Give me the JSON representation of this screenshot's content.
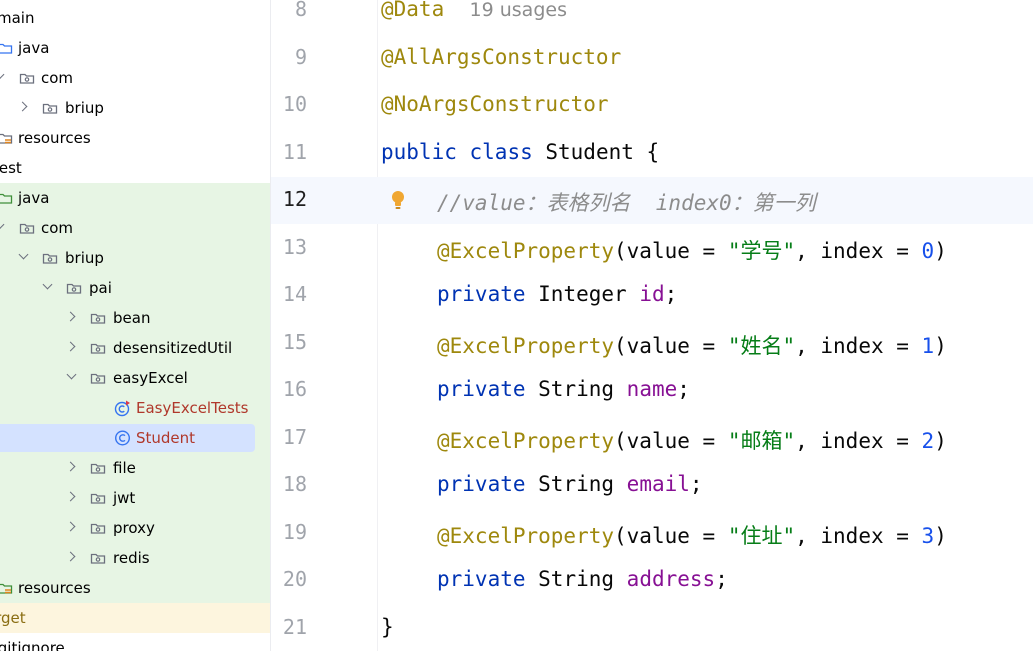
{
  "project_tree": {
    "rows": [
      {
        "label": "main",
        "icon": "none",
        "type": "folder"
      },
      {
        "label": "java",
        "icon": "source-folder-icon",
        "type": "folder"
      },
      {
        "label": "com",
        "icon": "package-icon",
        "type": "package"
      },
      {
        "label": "briup",
        "icon": "package-icon",
        "type": "package"
      },
      {
        "label": "resources",
        "icon": "resources-folder-icon",
        "type": "folder"
      },
      {
        "label": "test",
        "icon": "none",
        "type": "folder"
      },
      {
        "label": "java",
        "icon": "test-source-folder-icon",
        "type": "folder"
      },
      {
        "label": "com",
        "icon": "package-icon",
        "type": "package"
      },
      {
        "label": "briup",
        "icon": "package-icon",
        "type": "package"
      },
      {
        "label": "pai",
        "icon": "package-icon",
        "type": "package"
      },
      {
        "label": "bean",
        "icon": "package-icon",
        "type": "package"
      },
      {
        "label": "desensitizedUtil",
        "icon": "package-icon",
        "type": "package"
      },
      {
        "label": "easyExcel",
        "icon": "package-icon",
        "type": "package"
      },
      {
        "label": "EasyExcelTests",
        "icon": "test-class-icon",
        "type": "class"
      },
      {
        "label": "Student",
        "icon": "class-icon",
        "type": "class"
      },
      {
        "label": "file",
        "icon": "package-icon",
        "type": "package"
      },
      {
        "label": "jwt",
        "icon": "package-icon",
        "type": "package"
      },
      {
        "label": "proxy",
        "icon": "package-icon",
        "type": "package"
      },
      {
        "label": "redis",
        "icon": "package-icon",
        "type": "package"
      },
      {
        "label": "resources",
        "icon": "test-resources-folder-icon",
        "type": "folder"
      },
      {
        "label": "target",
        "icon": "none",
        "type": "folder"
      },
      {
        "label": ".gitignore",
        "icon": "none",
        "type": "file"
      }
    ],
    "selected": "Student"
  },
  "editor": {
    "hints": {
      "usages": "19 usages"
    },
    "lines": [
      {
        "num": "8",
        "tokens": [
          {
            "t": "@Data",
            "c": "ann"
          },
          {
            "t": "  ",
            "c": ""
          },
          {
            "t": "19 usages",
            "c": "hint"
          }
        ]
      },
      {
        "num": "9",
        "tokens": [
          {
            "t": "@AllArgsConstructor",
            "c": "ann"
          }
        ]
      },
      {
        "num": "10",
        "tokens": [
          {
            "t": "@NoArgsConstructor",
            "c": "ann"
          }
        ]
      },
      {
        "num": "11",
        "tokens": [
          {
            "t": "public ",
            "c": "kw"
          },
          {
            "t": "class ",
            "c": "kw"
          },
          {
            "t": "Student {",
            "c": ""
          }
        ]
      },
      {
        "num": "12",
        "tokens": [
          {
            "t": "//value：表格列名  index0：第一列",
            "c": "cmt"
          }
        ]
      },
      {
        "num": "13",
        "tokens": [
          {
            "t": "@ExcelProperty",
            "c": "ann"
          },
          {
            "t": "(value = ",
            "c": ""
          },
          {
            "t": "\"学号\"",
            "c": "str"
          },
          {
            "t": ", index = ",
            "c": ""
          },
          {
            "t": "0",
            "c": "num"
          },
          {
            "t": ")",
            "c": ""
          }
        ]
      },
      {
        "num": "14",
        "tokens": [
          {
            "t": "private ",
            "c": "kw"
          },
          {
            "t": "Integer ",
            "c": ""
          },
          {
            "t": "id",
            "c": "field"
          },
          {
            "t": ";",
            "c": ""
          }
        ]
      },
      {
        "num": "15",
        "tokens": [
          {
            "t": "@ExcelProperty",
            "c": "ann"
          },
          {
            "t": "(value = ",
            "c": ""
          },
          {
            "t": "\"姓名\"",
            "c": "str"
          },
          {
            "t": ", index = ",
            "c": ""
          },
          {
            "t": "1",
            "c": "num"
          },
          {
            "t": ")",
            "c": ""
          }
        ]
      },
      {
        "num": "16",
        "tokens": [
          {
            "t": "private ",
            "c": "kw"
          },
          {
            "t": "String ",
            "c": ""
          },
          {
            "t": "name",
            "c": "field"
          },
          {
            "t": ";",
            "c": ""
          }
        ]
      },
      {
        "num": "17",
        "tokens": [
          {
            "t": "@ExcelProperty",
            "c": "ann"
          },
          {
            "t": "(value = ",
            "c": ""
          },
          {
            "t": "\"邮箱\"",
            "c": "str"
          },
          {
            "t": ", index = ",
            "c": ""
          },
          {
            "t": "2",
            "c": "num"
          },
          {
            "t": ")",
            "c": ""
          }
        ]
      },
      {
        "num": "18",
        "tokens": [
          {
            "t": "private ",
            "c": "kw"
          },
          {
            "t": "String ",
            "c": ""
          },
          {
            "t": "email",
            "c": "field"
          },
          {
            "t": ";",
            "c": ""
          }
        ]
      },
      {
        "num": "19",
        "tokens": [
          {
            "t": "@ExcelProperty",
            "c": "ann"
          },
          {
            "t": "(value = ",
            "c": ""
          },
          {
            "t": "\"住址\"",
            "c": "str"
          },
          {
            "t": ", index = ",
            "c": ""
          },
          {
            "t": "3",
            "c": "num"
          },
          {
            "t": ")",
            "c": ""
          }
        ]
      },
      {
        "num": "20",
        "tokens": [
          {
            "t": "private ",
            "c": "kw"
          },
          {
            "t": "String ",
            "c": ""
          },
          {
            "t": "address",
            "c": "field"
          },
          {
            "t": ";",
            "c": ""
          }
        ]
      },
      {
        "num": "21",
        "tokens": [
          {
            "t": "}",
            "c": ""
          }
        ]
      }
    ],
    "current_line": "12",
    "intention_icon": "lightbulb-icon"
  },
  "colors": {
    "annotation": "#9e880d",
    "keyword": "#0033b3",
    "string": "#067d17",
    "number": "#1750eb",
    "field": "#871094",
    "comment": "#8c8c8c",
    "selection": "#d4e2ff",
    "test_background": "#e7f5e4",
    "ignored_background": "#fdf5de"
  }
}
